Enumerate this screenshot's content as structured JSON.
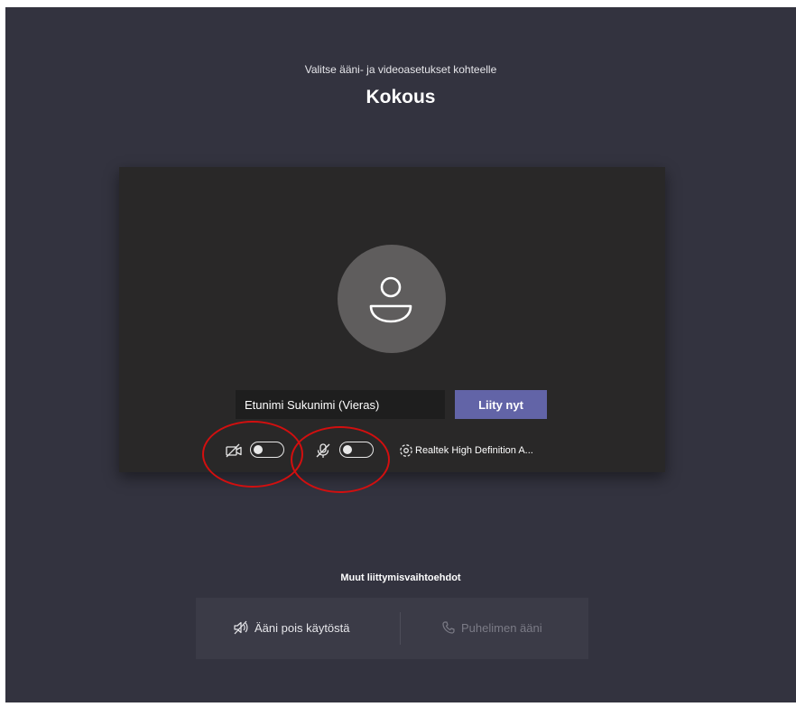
{
  "header": {
    "subtitle": "Valitse ääni- ja videoasetukset kohteelle",
    "meeting_title": "Kokous"
  },
  "preview": {
    "avatar_icon": "person-icon",
    "name_input_value": "Etunimi Sukunimi (Vieras)",
    "join_button_label": "Liity nyt"
  },
  "controls": {
    "camera_icon": "camera-off-icon",
    "camera_on": false,
    "mic_icon": "mic-off-icon",
    "mic_on": false,
    "settings_icon": "gear-icon",
    "audio_device": "Realtek High Definition A..."
  },
  "other_options": {
    "heading": "Muut liittymisvaihtoehdot",
    "audio_off_label": "Ääni pois käytöstä",
    "phone_audio_label": "Puhelimen ääni"
  },
  "colors": {
    "background": "#33333f",
    "preview_background": "#292828",
    "accent": "#6264a7",
    "highlight": "#d20f0f"
  }
}
